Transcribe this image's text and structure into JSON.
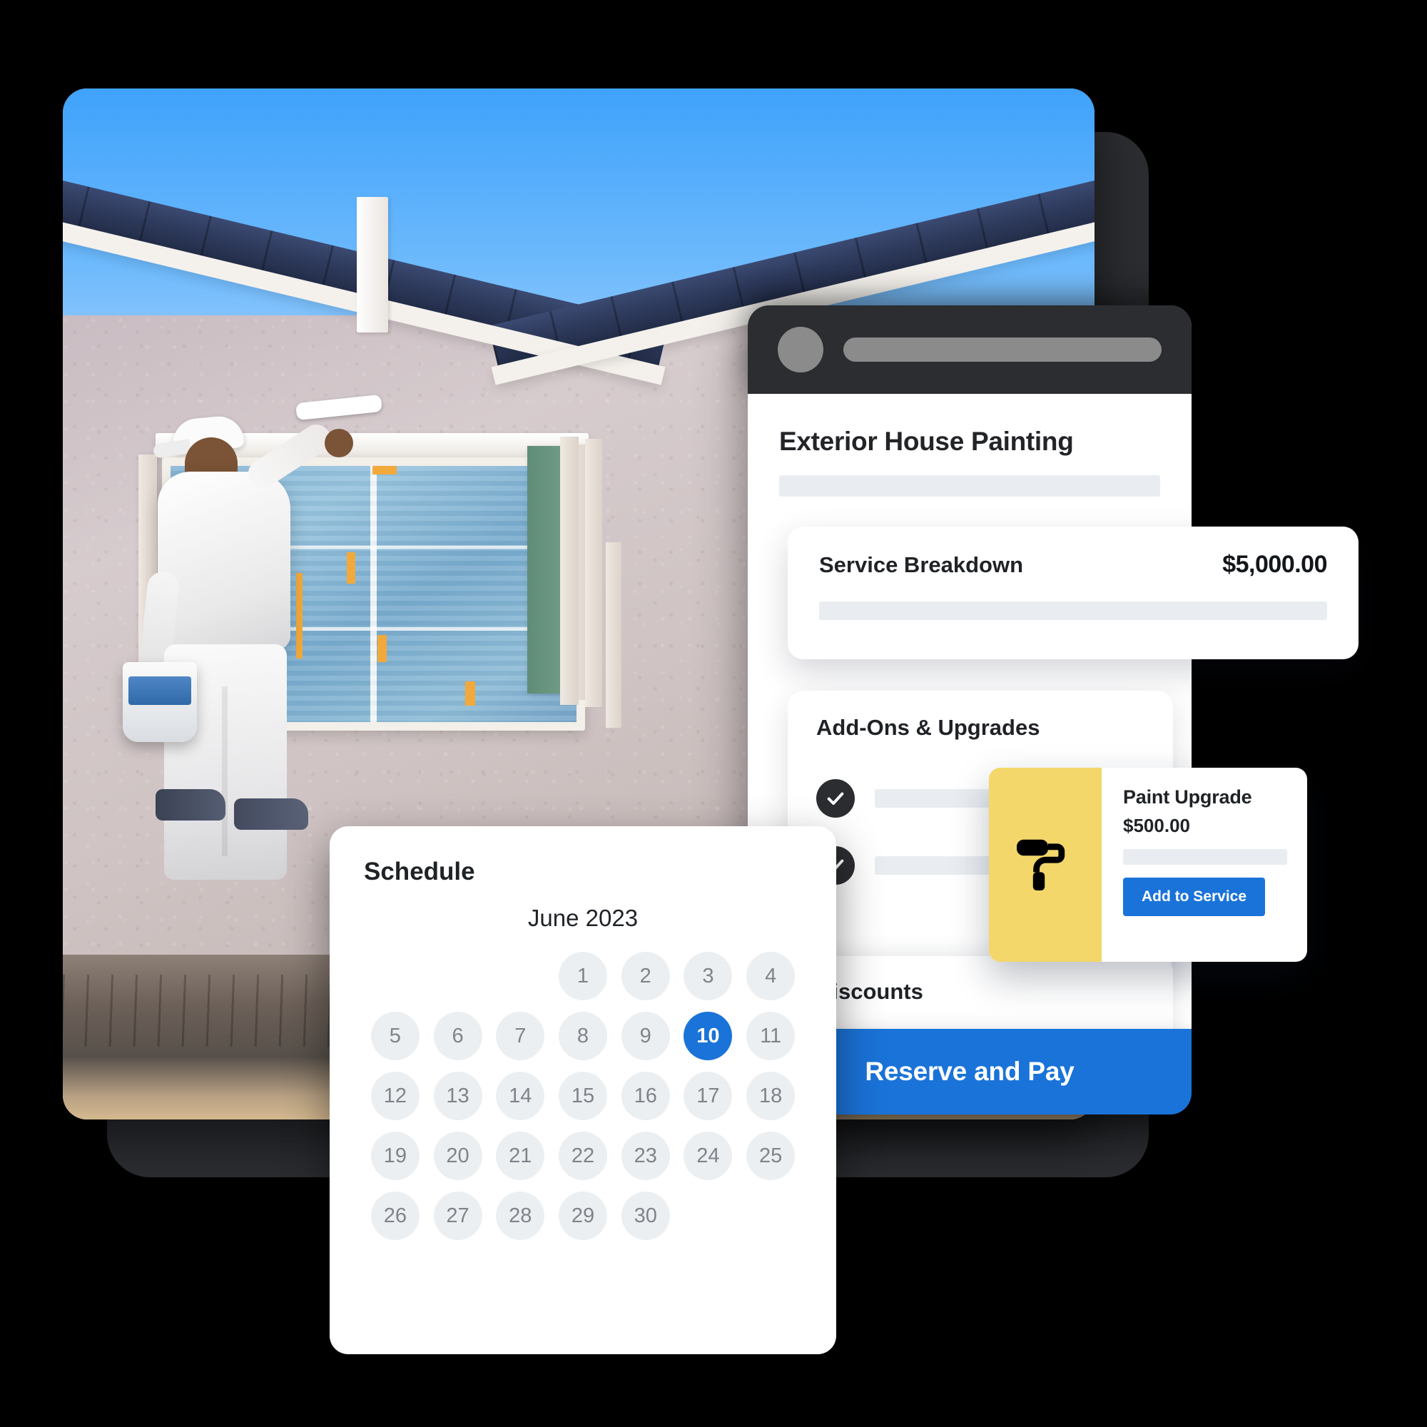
{
  "phone": {
    "topbar": {
      "avatar_icon": "avatar-circle-icon",
      "title_placeholder_bar": ""
    },
    "service_title": "Exterior House Painting",
    "reserve_button": "Reserve and Pay"
  },
  "breakdown": {
    "label": "Service Breakdown",
    "price": "$5,000.00"
  },
  "addons": {
    "title": "Add-Ons & Upgrades",
    "items": [
      {
        "checked": true,
        "check_icon": "check-icon"
      },
      {
        "checked": true,
        "check_icon": "check-icon"
      }
    ]
  },
  "discounts": {
    "title": "Discounts"
  },
  "paint_upgrade": {
    "icon": "paint-roller-icon",
    "title": "Paint Upgrade",
    "price": "$500.00",
    "button": "Add to Service",
    "accent_bg": "#f3d76a",
    "button_color": "#1a73d8"
  },
  "schedule": {
    "title": "Schedule",
    "month": "June 2023",
    "leading_blanks": 3,
    "days": [
      1,
      2,
      3,
      4,
      5,
      6,
      7,
      8,
      9,
      10,
      11,
      12,
      13,
      14,
      15,
      16,
      17,
      18,
      19,
      20,
      21,
      22,
      23,
      24,
      25,
      26,
      27,
      28,
      29,
      30
    ],
    "selected_day": 10
  },
  "colors": {
    "accent_blue": "#1a73d8",
    "dark_chrome": "#2b2d31",
    "page_background": "#000000",
    "skeleton": "#e9edf1"
  },
  "photo": {
    "alt": "house painter in white overalls painting exterior stucco wall near masked window"
  }
}
